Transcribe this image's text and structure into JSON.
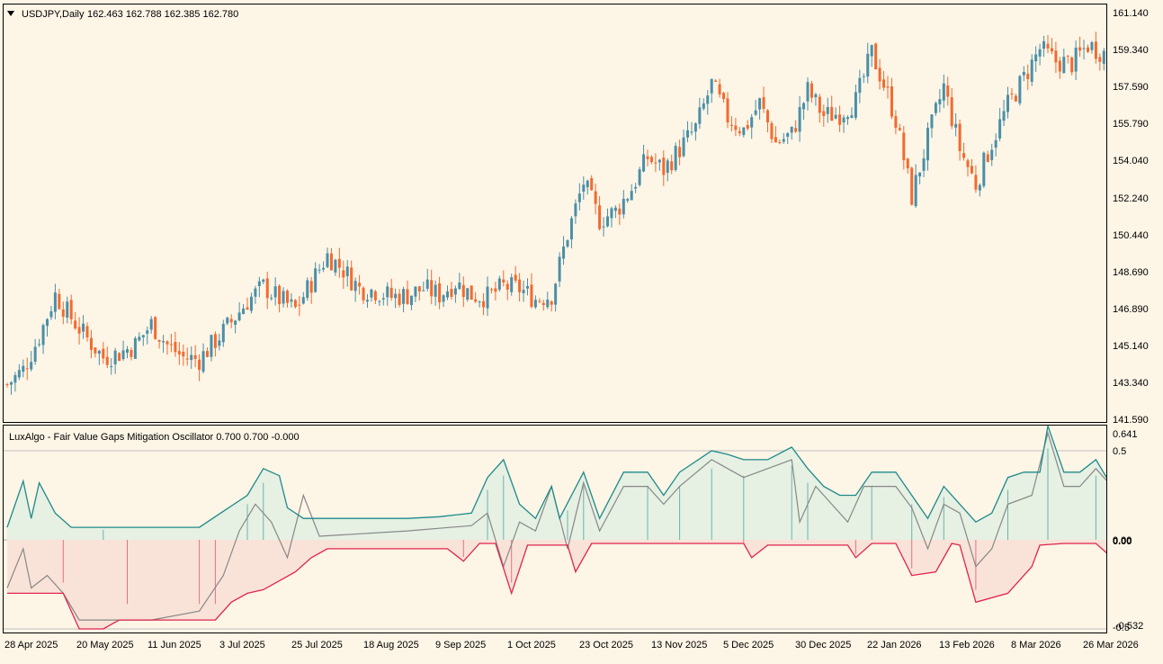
{
  "colors": {
    "background": "#fdf5e6",
    "bull": "#4a8fa8",
    "bear": "#f26a2f",
    "osc_upper": "#1e8a8a",
    "osc_lower": "#e0244e",
    "osc_mid": "#888888",
    "fill_bull": "#e6f0e3",
    "fill_bear": "#f9e3d8",
    "frame": "#000000",
    "level_line": "#c0c0c0"
  },
  "main_panel": {
    "symbol_label": "USDJPY,Daily",
    "ohlc_label": "162.463 162.788 162.385 162.780",
    "marker_icon": "triangle-down-icon"
  },
  "osc_panel": {
    "title": "LuxAlgo - Fair Value Gaps Mitigation Oscillator 0.700 0.700 -0.000"
  },
  "price_axis_labels": [
    "161.140",
    "159.340",
    "157.590",
    "155.790",
    "154.040",
    "152.240",
    "150.440",
    "148.690",
    "146.890",
    "145.140",
    "143.340",
    "141.590"
  ],
  "osc_axis_labels": [
    "0.641",
    "0.5",
    "0.00",
    "0.00",
    "-0.5",
    "-0.532"
  ],
  "date_axis_labels": [
    "28 Apr 2025",
    "20 May 2025",
    "11 Jun 2025",
    "3 Jul 2025",
    "25 Jul 2025",
    "18 Aug 2025",
    "9 Sep 2025",
    "1 Oct 2025",
    "23 Oct 2025",
    "13 Nov 2025",
    "5 Dec 2025",
    "30 Dec 2025",
    "22 Jan 2026",
    "13 Feb 2026",
    "8 Mar 2026",
    "26 Mar 2026"
  ],
  "chart_data": [
    {
      "type": "candlestick",
      "title": "USDJPY,Daily",
      "ylim": [
        141.59,
        161.14
      ],
      "x_range": [
        "28 Apr 2025",
        "27 Mar 2026"
      ],
      "close_path": [
        [
          0,
          143.3
        ],
        [
          4,
          144.0
        ],
        [
          8,
          145.6
        ],
        [
          12,
          147.6
        ],
        [
          16,
          146.5
        ],
        [
          20,
          145.5
        ],
        [
          24,
          144.6
        ],
        [
          28,
          144.8
        ],
        [
          32,
          145.2
        ],
        [
          36,
          146.2
        ],
        [
          40,
          145.2
        ],
        [
          44,
          144.6
        ],
        [
          48,
          144.5
        ],
        [
          52,
          145.4
        ],
        [
          56,
          146.3
        ],
        [
          60,
          147.3
        ],
        [
          64,
          148.0
        ],
        [
          68,
          147.4
        ],
        [
          72,
          146.9
        ],
        [
          76,
          148.2
        ],
        [
          80,
          149.5
        ],
        [
          84,
          148.8
        ],
        [
          88,
          147.9
        ],
        [
          92,
          147.8
        ],
        [
          96,
          147.5
        ],
        [
          100,
          147.6
        ],
        [
          104,
          147.9
        ],
        [
          108,
          147.6
        ],
        [
          112,
          148.2
        ],
        [
          116,
          147.6
        ],
        [
          120,
          147.5
        ],
        [
          124,
          148.0
        ],
        [
          128,
          147.9
        ],
        [
          132,
          147.4
        ],
        [
          136,
          147.6
        ],
        [
          140,
          150.5
        ],
        [
          144,
          153.0
        ],
        [
          148,
          151.2
        ],
        [
          152,
          151.6
        ],
        [
          156,
          152.7
        ],
        [
          160,
          154.2
        ],
        [
          164,
          153.6
        ],
        [
          168,
          154.6
        ],
        [
          172,
          155.6
        ],
        [
          176,
          157.7
        ],
        [
          180,
          156.1
        ],
        [
          184,
          155.5
        ],
        [
          188,
          156.8
        ],
        [
          192,
          154.9
        ],
        [
          196,
          155.3
        ],
        [
          200,
          157.4
        ],
        [
          204,
          156.2
        ],
        [
          208,
          156.3
        ],
        [
          212,
          156.9
        ],
        [
          216,
          159.2
        ],
        [
          220,
          157.2
        ],
        [
          222,
          156.0
        ],
        [
          226,
          152.3
        ],
        [
          230,
          155.1
        ],
        [
          234,
          157.6
        ],
        [
          238,
          154.6
        ],
        [
          242,
          152.9
        ],
        [
          246,
          154.9
        ],
        [
          250,
          156.7
        ],
        [
          254,
          158.0
        ],
        [
          258,
          159.4
        ],
        [
          262,
          158.8
        ],
        [
          266,
          158.7
        ],
        [
          270,
          159.6
        ],
        [
          274,
          159.2
        ]
      ],
      "last_bar": {
        "open": 162.463,
        "high": 162.788,
        "low": 162.385,
        "close": 162.78
      }
    },
    {
      "type": "line",
      "title": "LuxAlgo - Fair Value Gaps Mitigation Oscillator",
      "ylim": [
        -0.532,
        0.641
      ],
      "levels": [
        0.5,
        0.0,
        -0.5
      ],
      "series": [
        {
          "name": "",
          "role": "bullish-fvg",
          "values": [
            [
              0,
              0.07
            ],
            [
              4,
              0.33
            ],
            [
              6,
              0.12
            ],
            [
              8,
              0.32
            ],
            [
              12,
              0.15
            ],
            [
              16,
              0.07
            ],
            [
              24,
              0.07
            ],
            [
              40,
              0.07
            ],
            [
              48,
              0.07
            ],
            [
              60,
              0.25
            ],
            [
              64,
              0.4
            ],
            [
              68,
              0.36
            ],
            [
              70,
              0.18
            ],
            [
              74,
              0.12
            ],
            [
              100,
              0.12
            ],
            [
              108,
              0.13
            ],
            [
              116,
              0.15
            ],
            [
              120,
              0.35
            ],
            [
              124,
              0.45
            ],
            [
              128,
              0.2
            ],
            [
              132,
              0.12
            ],
            [
              136,
              0.3
            ],
            [
              138,
              0.12
            ],
            [
              144,
              0.38
            ],
            [
              148,
              0.12
            ],
            [
              154,
              0.38
            ],
            [
              160,
              0.38
            ],
            [
              164,
              0.25
            ],
            [
              168,
              0.38
            ],
            [
              176,
              0.5
            ],
            [
              180,
              0.48
            ],
            [
              184,
              0.45
            ],
            [
              190,
              0.45
            ],
            [
              196,
              0.52
            ],
            [
              200,
              0.4
            ],
            [
              204,
              0.3
            ],
            [
              208,
              0.25
            ],
            [
              212,
              0.25
            ],
            [
              216,
              0.38
            ],
            [
              222,
              0.38
            ],
            [
              226,
              0.25
            ],
            [
              230,
              0.12
            ],
            [
              234,
              0.3
            ],
            [
              238,
              0.2
            ],
            [
              242,
              0.1
            ],
            [
              246,
              0.15
            ],
            [
              250,
              0.35
            ],
            [
              254,
              0.38
            ],
            [
              258,
              0.38
            ],
            [
              260,
              0.64
            ],
            [
              264,
              0.38
            ],
            [
              268,
              0.38
            ],
            [
              272,
              0.45
            ],
            [
              276,
              0.3
            ]
          ]
        },
        {
          "name": "",
          "role": "bearish-fvg",
          "values": [
            [
              0,
              -0.3
            ],
            [
              8,
              -0.3
            ],
            [
              14,
              -0.3
            ],
            [
              18,
              -0.5
            ],
            [
              24,
              -0.5
            ],
            [
              28,
              -0.45
            ],
            [
              36,
              -0.45
            ],
            [
              48,
              -0.45
            ],
            [
              52,
              -0.45
            ],
            [
              56,
              -0.35
            ],
            [
              60,
              -0.3
            ],
            [
              64,
              -0.28
            ],
            [
              72,
              -0.18
            ],
            [
              76,
              -0.1
            ],
            [
              80,
              -0.05
            ],
            [
              84,
              -0.05
            ],
            [
              100,
              -0.05
            ],
            [
              110,
              -0.05
            ],
            [
              114,
              -0.12
            ],
            [
              118,
              -0.02
            ],
            [
              122,
              -0.02
            ],
            [
              126,
              -0.3
            ],
            [
              130,
              -0.03
            ],
            [
              140,
              -0.03
            ],
            [
              142,
              -0.18
            ],
            [
              146,
              -0.02
            ],
            [
              184,
              -0.02
            ],
            [
              186,
              -0.1
            ],
            [
              190,
              -0.03
            ],
            [
              210,
              -0.03
            ],
            [
              212,
              -0.1
            ],
            [
              216,
              -0.02
            ],
            [
              222,
              -0.02
            ],
            [
              226,
              -0.2
            ],
            [
              232,
              -0.18
            ],
            [
              236,
              -0.02
            ],
            [
              238,
              -0.03
            ],
            [
              242,
              -0.35
            ],
            [
              250,
              -0.3
            ],
            [
              256,
              -0.15
            ],
            [
              258,
              -0.03
            ],
            [
              264,
              -0.02
            ],
            [
              272,
              -0.02
            ],
            [
              276,
              -0.1
            ]
          ]
        },
        {
          "name": "",
          "role": "oscillator",
          "values": [
            [
              0,
              -0.27
            ],
            [
              4,
              -0.05
            ],
            [
              6,
              -0.27
            ],
            [
              10,
              -0.2
            ],
            [
              14,
              -0.3
            ],
            [
              18,
              -0.45
            ],
            [
              24,
              -0.45
            ],
            [
              36,
              -0.45
            ],
            [
              48,
              -0.4
            ],
            [
              54,
              -0.2
            ],
            [
              58,
              0.05
            ],
            [
              62,
              0.2
            ],
            [
              66,
              0.1
            ],
            [
              70,
              -0.1
            ],
            [
              74,
              0.25
            ],
            [
              78,
              0.02
            ],
            [
              100,
              0.05
            ],
            [
              116,
              0.08
            ],
            [
              120,
              0.15
            ],
            [
              124,
              -0.15
            ],
            [
              128,
              0.1
            ],
            [
              132,
              0.05
            ],
            [
              136,
              0.3
            ],
            [
              140,
              -0.05
            ],
            [
              144,
              0.32
            ],
            [
              148,
              0.05
            ],
            [
              154,
              0.3
            ],
            [
              160,
              0.3
            ],
            [
              164,
              0.2
            ],
            [
              168,
              0.3
            ],
            [
              176,
              0.45
            ],
            [
              180,
              0.4
            ],
            [
              184,
              0.35
            ],
            [
              190,
              0.4
            ],
            [
              196,
              0.45
            ],
            [
              198,
              0.1
            ],
            [
              202,
              0.3
            ],
            [
              206,
              0.2
            ],
            [
              210,
              0.1
            ],
            [
              214,
              0.3
            ],
            [
              222,
              0.3
            ],
            [
              226,
              0.18
            ],
            [
              230,
              -0.05
            ],
            [
              234,
              0.2
            ],
            [
              238,
              0.15
            ],
            [
              242,
              -0.15
            ],
            [
              246,
              -0.05
            ],
            [
              250,
              0.2
            ],
            [
              256,
              0.25
            ],
            [
              260,
              0.6
            ],
            [
              264,
              0.3
            ],
            [
              268,
              0.3
            ],
            [
              272,
              0.4
            ],
            [
              276,
              0.3
            ]
          ]
        }
      ]
    }
  ]
}
